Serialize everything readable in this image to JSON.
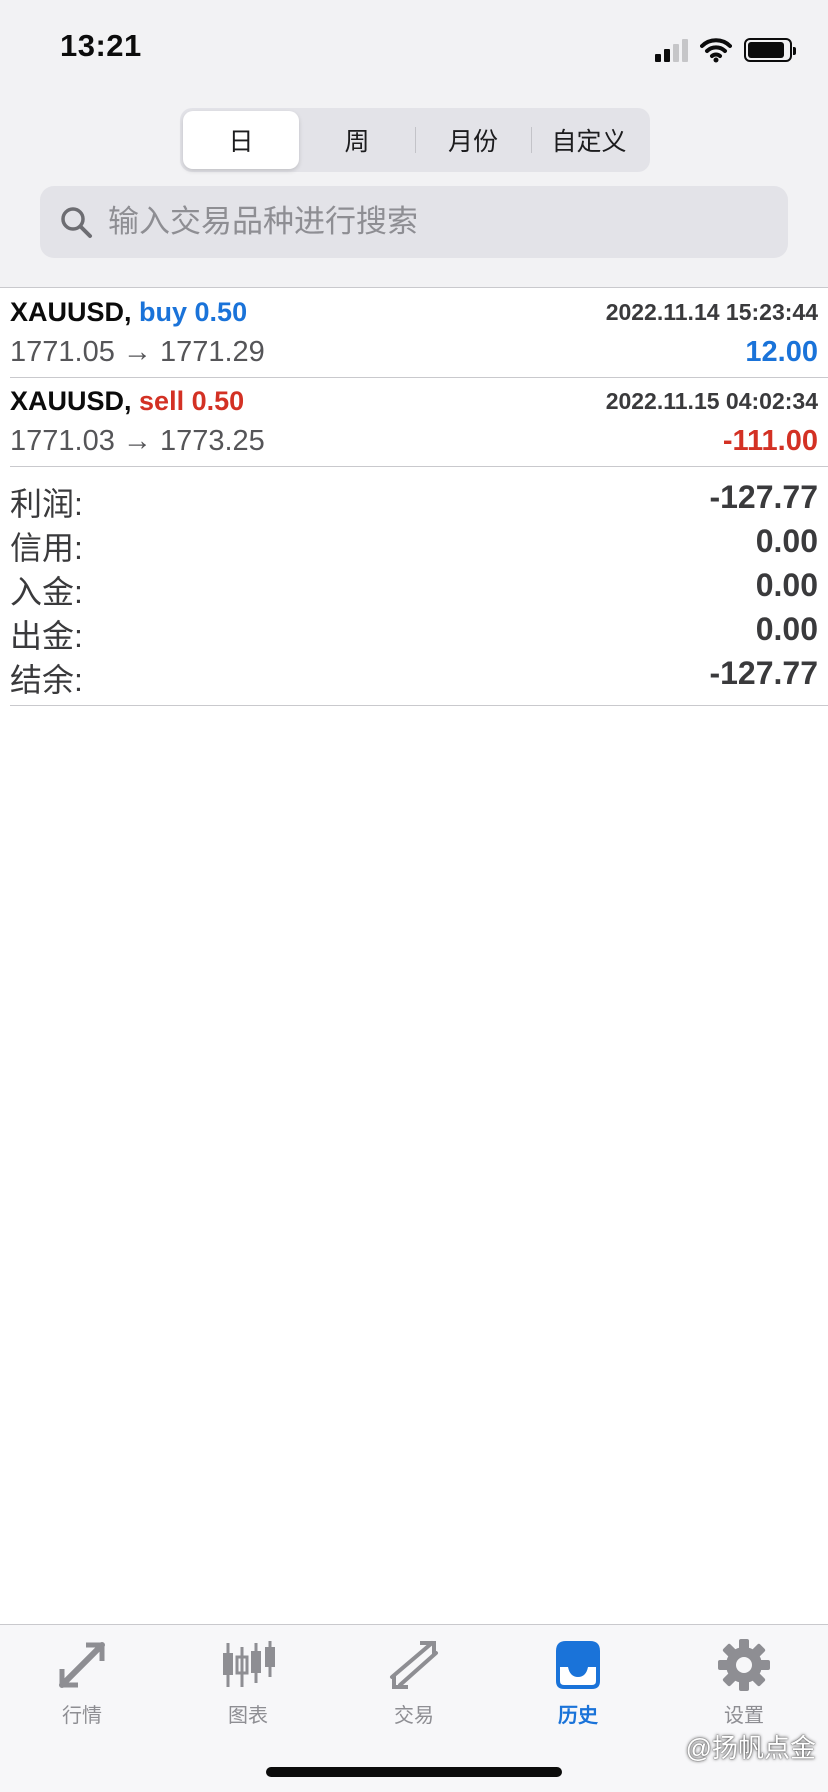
{
  "status_bar": {
    "time": "13:21"
  },
  "segments": [
    {
      "label": "日",
      "active": true
    },
    {
      "label": "周",
      "active": false
    },
    {
      "label": "月份",
      "active": false
    },
    {
      "label": "自定义",
      "active": false
    }
  ],
  "search": {
    "placeholder": "输入交易品种进行搜索",
    "value": ""
  },
  "deals": [
    {
      "symbol": "XAUUSD,",
      "type": "buy 0.50",
      "type_color": "#1a73d9",
      "time": "2022.11.14 15:23:44",
      "prices": "1771.05 → 1771.29",
      "profit": "12.00",
      "profit_color": "#1a73d9"
    },
    {
      "symbol": "XAUUSD,",
      "type": "sell 0.50",
      "type_color": "#d33124",
      "time": "2022.11.15 04:02:34",
      "prices": "1771.03 → 1773.25",
      "profit": "-111.00",
      "profit_color": "#d33124"
    }
  ],
  "summary": [
    {
      "label": "利润:",
      "value": "-127.77"
    },
    {
      "label": "信用:",
      "value": "0.00"
    },
    {
      "label": "入金:",
      "value": "0.00"
    },
    {
      "label": "出金:",
      "value": "0.00"
    },
    {
      "label": "结余:",
      "value": "-127.77"
    }
  ],
  "tabs": [
    {
      "label": "行情",
      "icon": "quotes-icon",
      "active": false
    },
    {
      "label": "图表",
      "icon": "chart-icon",
      "active": false
    },
    {
      "label": "交易",
      "icon": "trade-icon",
      "active": false
    },
    {
      "label": "历史",
      "icon": "history-icon",
      "active": true
    },
    {
      "label": "设置",
      "icon": "settings-icon",
      "active": false
    }
  ],
  "watermark": "@扬帆点金",
  "colors": {
    "accent": "#1a73d9",
    "negative": "#d33124",
    "inactive": "#8e8e93"
  }
}
